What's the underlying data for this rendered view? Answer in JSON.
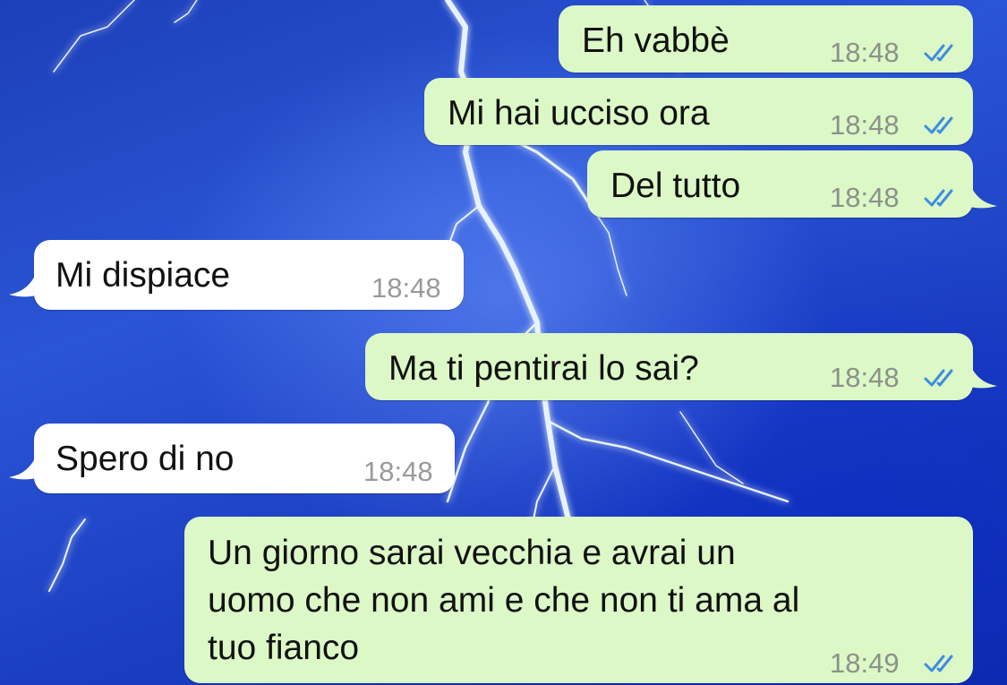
{
  "colors": {
    "outgoing_bubble": "#dcf8c6",
    "incoming_bubble": "#ffffff",
    "read_ticks": "#3d8de0",
    "wallpaper": "#1f45c4"
  },
  "icons": {
    "read_receipt": "double-check-icon"
  },
  "messages": [
    {
      "direction": "outgoing",
      "text": "Eh vabbè",
      "time": "18:48",
      "status": "read"
    },
    {
      "direction": "outgoing",
      "text": "Mi hai ucciso ora",
      "time": "18:48",
      "status": "read"
    },
    {
      "direction": "outgoing",
      "text": "Del tutto",
      "time": "18:48",
      "status": "read"
    },
    {
      "direction": "incoming",
      "text": "Mi dispiace",
      "time": "18:48"
    },
    {
      "direction": "outgoing",
      "text": "Ma ti pentirai lo sai?",
      "time": "18:48",
      "status": "read"
    },
    {
      "direction": "incoming",
      "text": "Spero di no",
      "time": "18:48"
    },
    {
      "direction": "outgoing",
      "lines": [
        "Un giorno sarai vecchia e avrai un",
        "uomo che non ami e che non ti ama al",
        "tuo fianco"
      ],
      "time": "18:49",
      "status": "read"
    }
  ]
}
